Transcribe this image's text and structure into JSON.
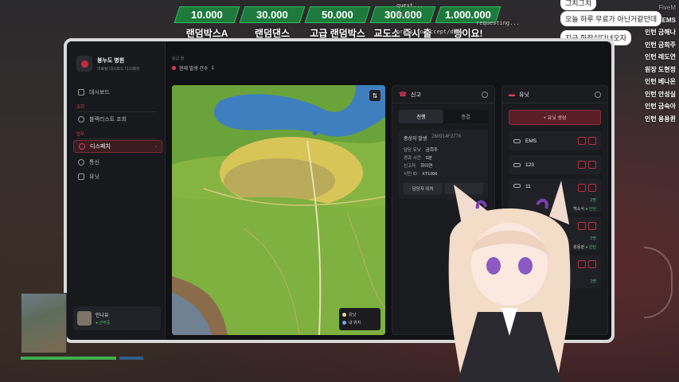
{
  "donations": [
    {
      "amount": "10.000",
      "label": "랜덤박스A"
    },
    {
      "amount": "30.000",
      "label": "랜덤댄스"
    },
    {
      "amount": "50.000",
      "label": "고급 랜덤박스A"
    },
    {
      "amount": "300.000",
      "label": "교도소 즉시 출소"
    },
    {
      "amount": "1.000.000",
      "label": "뻥이요!"
    }
  ],
  "debug_lines": [
    "quest...",
    "at h...",
    "requesting...",
    "press to accept/deny"
  ],
  "chat": [
    {
      "text": "그치그치"
    },
    {
      "text": "오늘 하루 무료가 아닌거같던데"
    },
    {
      "text": "지금 화장실다녀오자"
    },
    {
      "text": "?"
    }
  ],
  "players": [
    "FiveM",
    "EMS",
    "인턴 금해나",
    "인턴 금희주",
    "인턴 레도연",
    "원장 도현정",
    "인턴 베나온",
    "인턴 안성실",
    "인턴 금숙아",
    "인턴 용용퀸"
  ],
  "app": {
    "title": "붕누도 병원",
    "subtitle": "의료팀 대시보드 디스패치",
    "nav": {
      "dashboard": "대시보드",
      "section_lookup": "조회",
      "blacklist": "블랙리스트 조회",
      "section_duty": "업무",
      "dispatch": "디스패치",
      "comms": "통신",
      "units": "유닛"
    },
    "user": {
      "name": "인나유",
      "status": "● 근무중"
    }
  },
  "header": {
    "tiny": "응급 콜",
    "current": "현재 발생 건수",
    "count": "1"
  },
  "map": {
    "legend_unit": "유닛",
    "legend_me": "내 위치"
  },
  "reports": {
    "title": "신고",
    "tab_active": "진행",
    "tab_done": "종결",
    "item": {
      "type": "중상자 발생",
      "id": "260914F2776",
      "k1": "담당 유닛",
      "v1": "금희주",
      "k2": "경과 시간",
      "v2": "0분",
      "k3": "신고자",
      "v3": "하이연",
      "k4": "시민 ID",
      "v4": "XT1006",
      "btn_locate": "담당자 위치",
      "btn_other": ""
    }
  },
  "units": {
    "title": "유닛",
    "add": "+ 유닛 생성",
    "list": [
      {
        "name": "EMS"
      },
      {
        "name": "123"
      },
      {
        "name": "11",
        "count": "2명",
        "member": "백소식",
        "member_status": "● 인턴"
      },
      {
        "name": "",
        "count": "2명",
        "member": "용용퀸",
        "member_status": "● 인턴"
      },
      {
        "name": "",
        "count": "1명",
        "member": "",
        "member_status": ""
      }
    ]
  },
  "colors": {
    "accent": "#d14356",
    "online": "#39c46a",
    "donation": "#1d7a3c"
  }
}
